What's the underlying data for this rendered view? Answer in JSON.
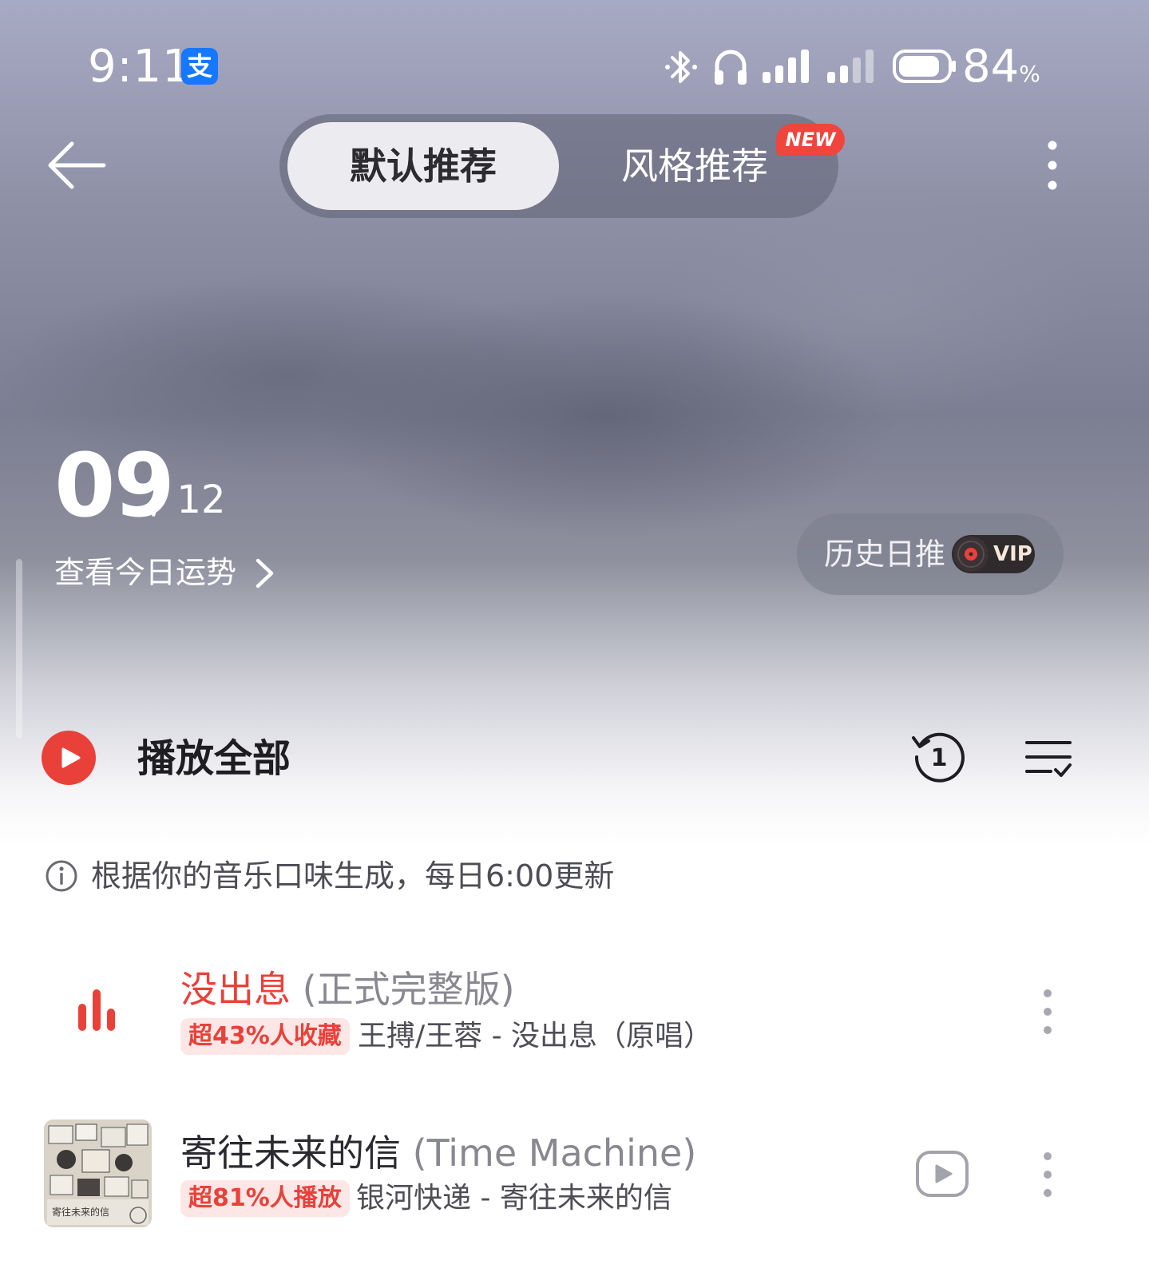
{
  "status_bar": {
    "time": "9:11",
    "app_badge": "支",
    "battery": "84",
    "battery_unit": "%",
    "icons": [
      "alipay-icon",
      "bluetooth-icon",
      "headphones-icon",
      "signal-icon",
      "signal-icon",
      "battery-icon"
    ]
  },
  "nav": {
    "tabs": [
      {
        "label": "默认推荐",
        "active": true
      },
      {
        "label": "风格推荐",
        "active": false
      }
    ],
    "new_badge": "NEW"
  },
  "date": {
    "day": "09",
    "month": "/ 12",
    "fortune_link": "查看今日运势"
  },
  "history": {
    "label": "历史日推",
    "vip": "VIP"
  },
  "actions": {
    "play_all": "播放全部",
    "history_count": "1"
  },
  "info": {
    "text": "根据你的音乐口味生成，每日6:00更新"
  },
  "songs": [
    {
      "title": "没出息",
      "subtitle": " (正式完整版)",
      "tag": "超43%人收藏",
      "artist_album": "王搏/王蓉 - 没出息（原唱）",
      "playing": true
    },
    {
      "title": "寄往未来的信",
      "subtitle": " (Time Machine)",
      "tag": "超81%人播放",
      "artist_album": "银河快递 - 寄往未来的信",
      "playing": false,
      "cover_text": "寄往未来的信"
    }
  ],
  "colors": {
    "accent_red": "#e9413a",
    "tag_bg": "#fde7e6"
  }
}
